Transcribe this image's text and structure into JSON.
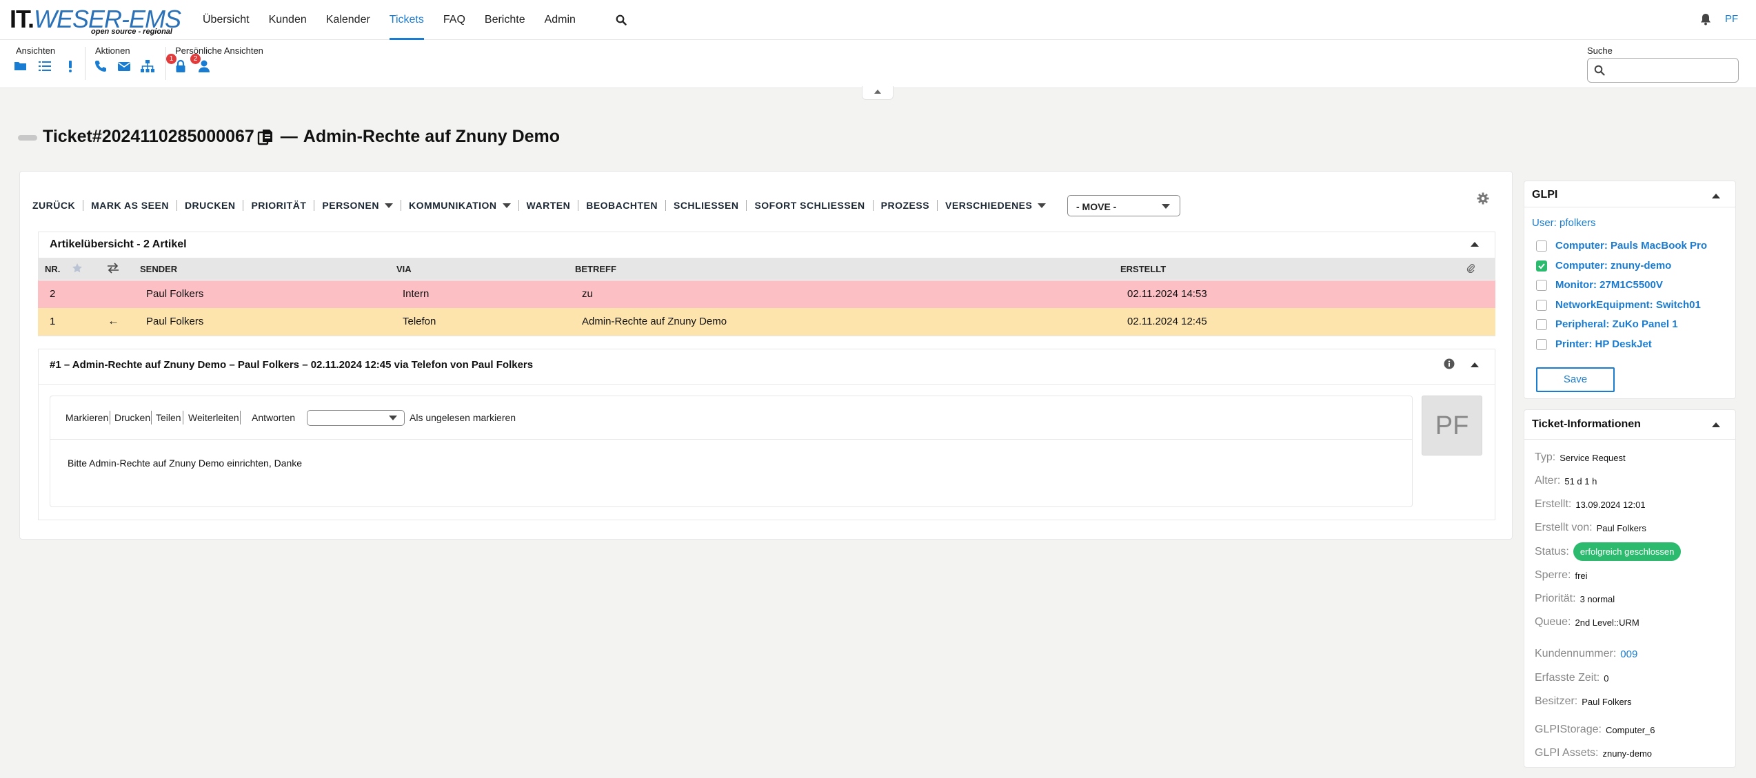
{
  "header": {
    "logo": {
      "part1": "IT.",
      "part2": "WESER-EMS",
      "tagline": "open source - regional"
    },
    "nav": [
      {
        "label": "Übersicht"
      },
      {
        "label": "Kunden"
      },
      {
        "label": "Kalender"
      },
      {
        "label": "Tickets",
        "active": true
      },
      {
        "label": "FAQ"
      },
      {
        "label": "Berichte"
      },
      {
        "label": "Admin"
      }
    ],
    "user_initials": "PF"
  },
  "toolbar": {
    "views_label": "Ansichten",
    "actions_label": "Aktionen",
    "personal_label": "Persönliche Ansichten",
    "locked_badge": "1",
    "responsible_badge": "2",
    "search_label": "Suche",
    "search_value": ""
  },
  "ticket": {
    "number": "Ticket#2024110285000067",
    "separator": "—",
    "title": "Admin-Rechte auf Znuny Demo"
  },
  "actions": [
    {
      "label": "ZURÜCK"
    },
    {
      "label": "MARK AS SEEN"
    },
    {
      "label": "DRUCKEN"
    },
    {
      "label": "PRIORITÄT"
    },
    {
      "label": "PERSONEN",
      "dropdown": true
    },
    {
      "label": "KOMMUNIKATION",
      "dropdown": true
    },
    {
      "label": "WARTEN"
    },
    {
      "label": "BEOBACHTEN"
    },
    {
      "label": "SCHLIESSEN"
    },
    {
      "label": "SOFORT SCHLIESSEN"
    },
    {
      "label": "PROZESS"
    },
    {
      "label": "VERSCHIEDENES",
      "dropdown": true
    }
  ],
  "move_select": "- MOVE -",
  "articles": {
    "heading": "Artikelübersicht - 2 Artikel",
    "columns": {
      "nr": "NR.",
      "sender": "SENDER",
      "via": "VIA",
      "subject": "BETREFF",
      "created": "ERSTELLT"
    },
    "rows": [
      {
        "nr": "2",
        "direction": "",
        "sender": "Paul Folkers",
        "via": "Intern",
        "subject": "zu",
        "created": "02.11.2024 14:53",
        "color": "#fbbfc4"
      },
      {
        "nr": "1",
        "direction": "←",
        "sender": "Paul Folkers",
        "via": "Telefon",
        "subject": "Admin-Rechte auf Znuny Demo",
        "created": "02.11.2024 12:45",
        "color": "#fde4ad"
      }
    ]
  },
  "article_detail": {
    "heading": "#1 – Admin-Rechte auf Znuny Demo – Paul Folkers – 02.11.2024 12:45 via Telefon von Paul Folkers",
    "tools": {
      "mark": "Markieren",
      "print": "Drucken",
      "share": "Teilen",
      "forward": "Weiterleiten",
      "reply": "Antworten",
      "unread": "Als ungelesen markieren"
    },
    "body": "Bitte Admin-Rechte auf Znuny Demo einrichten, Danke",
    "avatar_initials": "PF"
  },
  "glpi": {
    "heading": "GLPI",
    "user": "User: pfolkers",
    "items": [
      {
        "label": "Computer: Pauls MacBook Pro",
        "checked": false
      },
      {
        "label": "Computer: znuny-demo",
        "checked": true
      },
      {
        "label": "Monitor: 27M1C5500V",
        "checked": false
      },
      {
        "label": "NetworkEquipment: Switch01",
        "checked": false
      },
      {
        "label": "Peripheral: ZuKo Panel 1",
        "checked": false
      },
      {
        "label": "Printer: HP DeskJet",
        "checked": false
      }
    ],
    "save_label": "Save"
  },
  "ticket_info": {
    "heading": "Ticket-Informationen",
    "type": {
      "k": "Typ:",
      "v": "Service Request"
    },
    "age": {
      "k": "Alter:",
      "v": "51 d 1 h"
    },
    "created": {
      "k": "Erstellt:",
      "v": "13.09.2024 12:01"
    },
    "created_by": {
      "k": "Erstellt von:",
      "v": "Paul Folkers"
    },
    "status": {
      "k": "Status:",
      "v": "erfolgreich geschlossen"
    },
    "lock": {
      "k": "Sperre:",
      "v": "frei"
    },
    "priority": {
      "k": "Priorität:",
      "v": "3 normal"
    },
    "queue": {
      "k": "Queue:",
      "v": "2nd Level::URM"
    },
    "customer_no": {
      "k": "Kundennummer:",
      "v": "009"
    },
    "time": {
      "k": "Erfasste Zeit:",
      "v": "0"
    },
    "owner": {
      "k": "Besitzer:",
      "v": "Paul Folkers"
    },
    "glpi_storage": {
      "k": "GLPIStorage:",
      "v": "Computer_6"
    },
    "glpi_assets": {
      "k": "GLPI Assets:",
      "v": "znuny-demo"
    }
  },
  "colors": {
    "accent": "#1a7cd1",
    "success": "#2cba6e",
    "row_internal": "#fbbfc4",
    "row_phone": "#fde4ad"
  }
}
